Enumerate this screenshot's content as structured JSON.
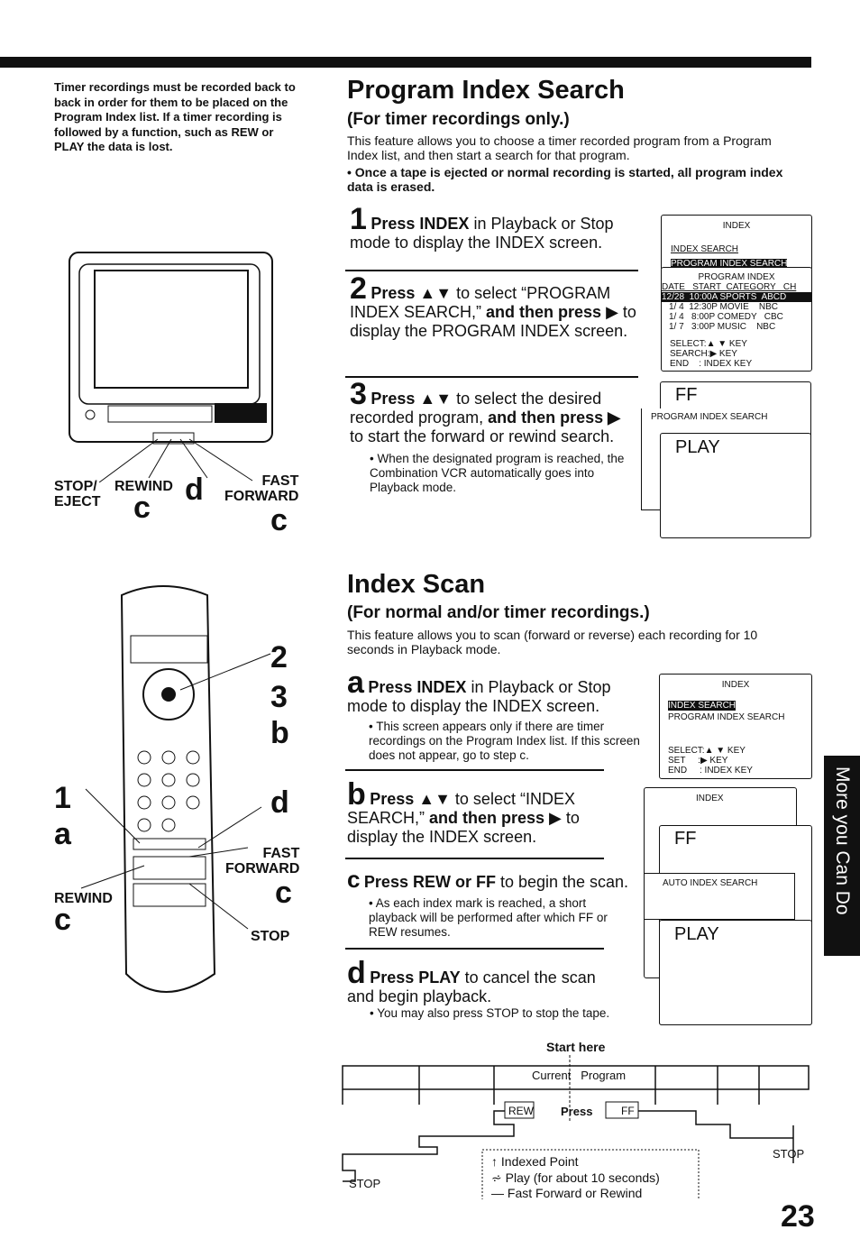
{
  "left_note": "Timer recordings must be recorded back to back in order for them to be placed on the Program Index list. If a timer recording is followed by a function, such as REW or PLAY the data is lost.",
  "pis": {
    "title": "Program Index Search",
    "subtitle": "(For timer recordings only.)",
    "intro": "This feature allows you to choose a timer recorded program from a Program Index list, and then start a search for that program.",
    "bullet": "• Once a tape is ejected or normal recording is started, all program index data is erased.",
    "steps": [
      {
        "num": "1",
        "bold": "Press INDEX",
        "text": " in Playback or Stop mode to display the INDEX screen."
      },
      {
        "num": "2",
        "bold": "Press ▲▼",
        "text": " to select “PROGRAM INDEX SEARCH,” ",
        "bold2": "and then press",
        "text2": " ▶ to display the PROGRAM INDEX screen."
      },
      {
        "num": "3",
        "bold": "Press ▲▼",
        "text": " to select the desired recorded program, ",
        "bold2": "and then press ▶",
        "text2": " to start the forward or rewind search.",
        "note": "• When the designated program is reached, the Combination VCR automatically goes into Playback mode."
      }
    ],
    "screen1": {
      "title": "INDEX",
      "item1": "INDEX SEARCH",
      "item2": "PROGRAM INDEX SEARCH"
    },
    "screen2": {
      "title": "PROGRAM INDEX",
      "header": "DATE   START  CATEGORY   CH",
      "rows": [
        "12/28  10:00A SPORTS  ABCD",
        "1/ 4  12:30P MOVIE    NBC",
        "1/ 4   8:00P COMEDY   CBC",
        "1/ 7   3:00P MUSIC    NBC"
      ],
      "keys": [
        "SELECT:▲ ▼ KEY",
        "SEARCH:▶ KEY",
        "END    : INDEX KEY"
      ]
    },
    "screen3": {
      "ff": "FF",
      "label": "PROGRAM INDEX SEARCH",
      "play": "PLAY"
    }
  },
  "tv_labels": {
    "stop": "STOP/\nEJECT",
    "rewind": "REWIND",
    "fast": "FAST\nFORWARD",
    "c1": "c",
    "d1": "d",
    "c2": "c"
  },
  "remote_labels": {
    "n2": "2",
    "n3": "3",
    "b": "b",
    "n1": "1",
    "a": "a",
    "d": "d",
    "fast": "FAST\nFORWARD",
    "c1": "c",
    "rewind": "REWIND",
    "c2": "c",
    "stop": "STOP"
  },
  "scan": {
    "title": "Index Scan",
    "subtitle": "(For normal and/or timer recordings.)",
    "intro": "This feature allows you to scan (forward or reverse) each recording for 10 seconds in Playback mode.",
    "steps": [
      {
        "num": "a",
        "bold": "Press INDEX",
        "text": " in Playback or Stop mode to display the INDEX screen.",
        "note": "• This screen appears only if there are timer recordings on the Program Index list. If this screen does not appear, go to step c."
      },
      {
        "num": "b",
        "bold": "Press ▲▼",
        "text": " to select “INDEX SEARCH,” ",
        "bold2": "and then press",
        "text2": " ▶ to display the INDEX screen."
      },
      {
        "num": "c",
        "bold": "Press REW or FF",
        "text": " to begin the scan.",
        "note": "• As each index mark is reached, a short playback will be performed after which FF or REW resumes."
      },
      {
        "num": "d",
        "bold": "Press PLAY",
        "text": " to cancel the scan and begin playback.",
        "note": "• You may also press STOP to stop the tape."
      }
    ],
    "screen1": {
      "title": "INDEX",
      "item1": "INDEX SEARCH",
      "item2": "PROGRAM INDEX SEARCH",
      "keys": [
        "SELECT:▲ ▼ KEY",
        "SET     :▶ KEY",
        "END     : INDEX KEY"
      ]
    },
    "screen2": {
      "title": "INDEX",
      "ff": "FF",
      "label": "AUTO INDEX SEARCH",
      "play": "PLAY"
    }
  },
  "diagram": {
    "start": "Start here",
    "current": "Current",
    "program": "Program",
    "rew": "REW",
    "press": "Press",
    "ff": "FF",
    "stop_left": "STOP",
    "stop_right": "STOP",
    "legend": [
      "Indexed Point",
      "Play (for about 10 seconds)",
      "Fast Forward or Rewind"
    ]
  },
  "side_tab": "More you Can Do",
  "page_number": "23"
}
